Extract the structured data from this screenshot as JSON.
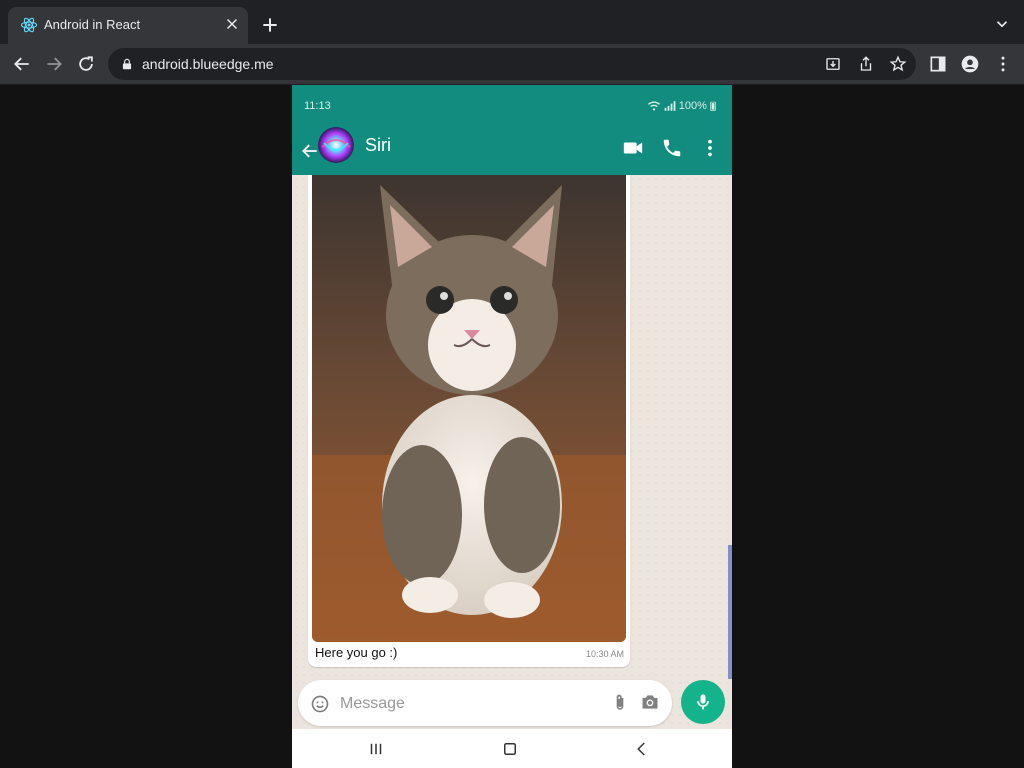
{
  "browser": {
    "tab_title": "Android in React",
    "url": "android.blueedge.me"
  },
  "phone": {
    "status": {
      "time": "11:13",
      "battery": "100%"
    },
    "chat": {
      "contact_name": "Siri",
      "message_caption": "Here you go :)",
      "message_time": "10:30 AM"
    },
    "composer": {
      "placeholder": "Message"
    }
  },
  "colors": {
    "browser_tabbar": "#202124",
    "browser_toolbar": "#35363a",
    "whatsapp_teal": "#128c7e",
    "chat_bg": "#ece5dd",
    "mic_green": "#14b38b"
  }
}
